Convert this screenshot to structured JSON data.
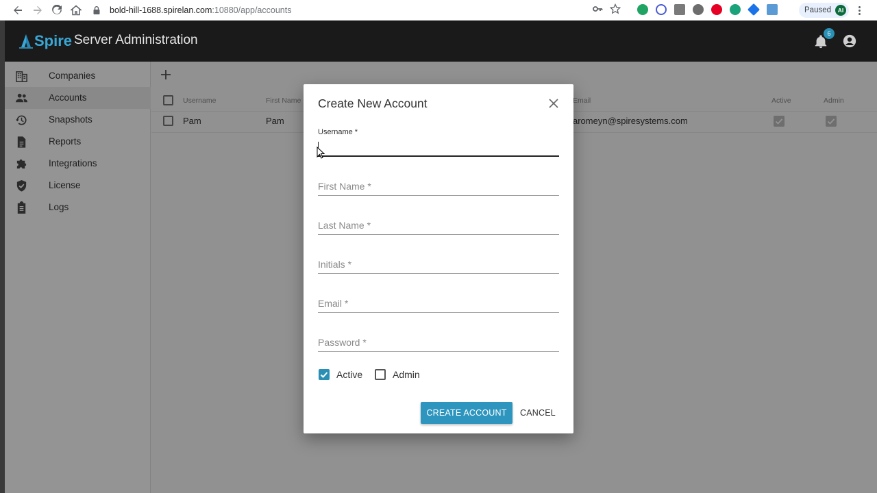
{
  "browser": {
    "url_host": "bold-hill-1688.spirelan.com",
    "url_path": ":10880/app/accounts",
    "profile_status": "Paused",
    "profile_initials": "AI"
  },
  "header": {
    "logo_text": "Spire",
    "title": "Server Administration",
    "notification_count": "6"
  },
  "sidebar": {
    "items": [
      {
        "label": "Companies",
        "icon": "building-icon"
      },
      {
        "label": "Accounts",
        "icon": "people-icon",
        "active": true
      },
      {
        "label": "Snapshots",
        "icon": "history-icon"
      },
      {
        "label": "Reports",
        "icon": "document-icon"
      },
      {
        "label": "Integrations",
        "icon": "puzzle-icon"
      },
      {
        "label": "License",
        "icon": "shield-check-icon"
      },
      {
        "label": "Logs",
        "icon": "clipboard-icon"
      }
    ]
  },
  "table": {
    "columns": [
      "Username",
      "First Name",
      "Email",
      "Active",
      "Admin"
    ],
    "rows": [
      {
        "username": "Pam",
        "first_name": "Pam",
        "email": "aromeyn@spiresystems.com",
        "active": true,
        "admin": true
      }
    ]
  },
  "dialog": {
    "title": "Create New Account",
    "fields": [
      {
        "label": "Username *",
        "value": ""
      },
      {
        "label": "First Name *",
        "value": ""
      },
      {
        "label": "Last Name *",
        "value": ""
      },
      {
        "label": "Initials *",
        "value": ""
      },
      {
        "label": "Email *",
        "value": ""
      },
      {
        "label": "Password *",
        "value": ""
      }
    ],
    "active_label": "Active",
    "active_checked": true,
    "admin_label": "Admin",
    "admin_checked": false,
    "create_label": "CREATE ACCOUNT",
    "cancel_label": "CANCEL"
  },
  "colors": {
    "accent": "#2e96be",
    "header_bg": "#1a1a1a"
  }
}
